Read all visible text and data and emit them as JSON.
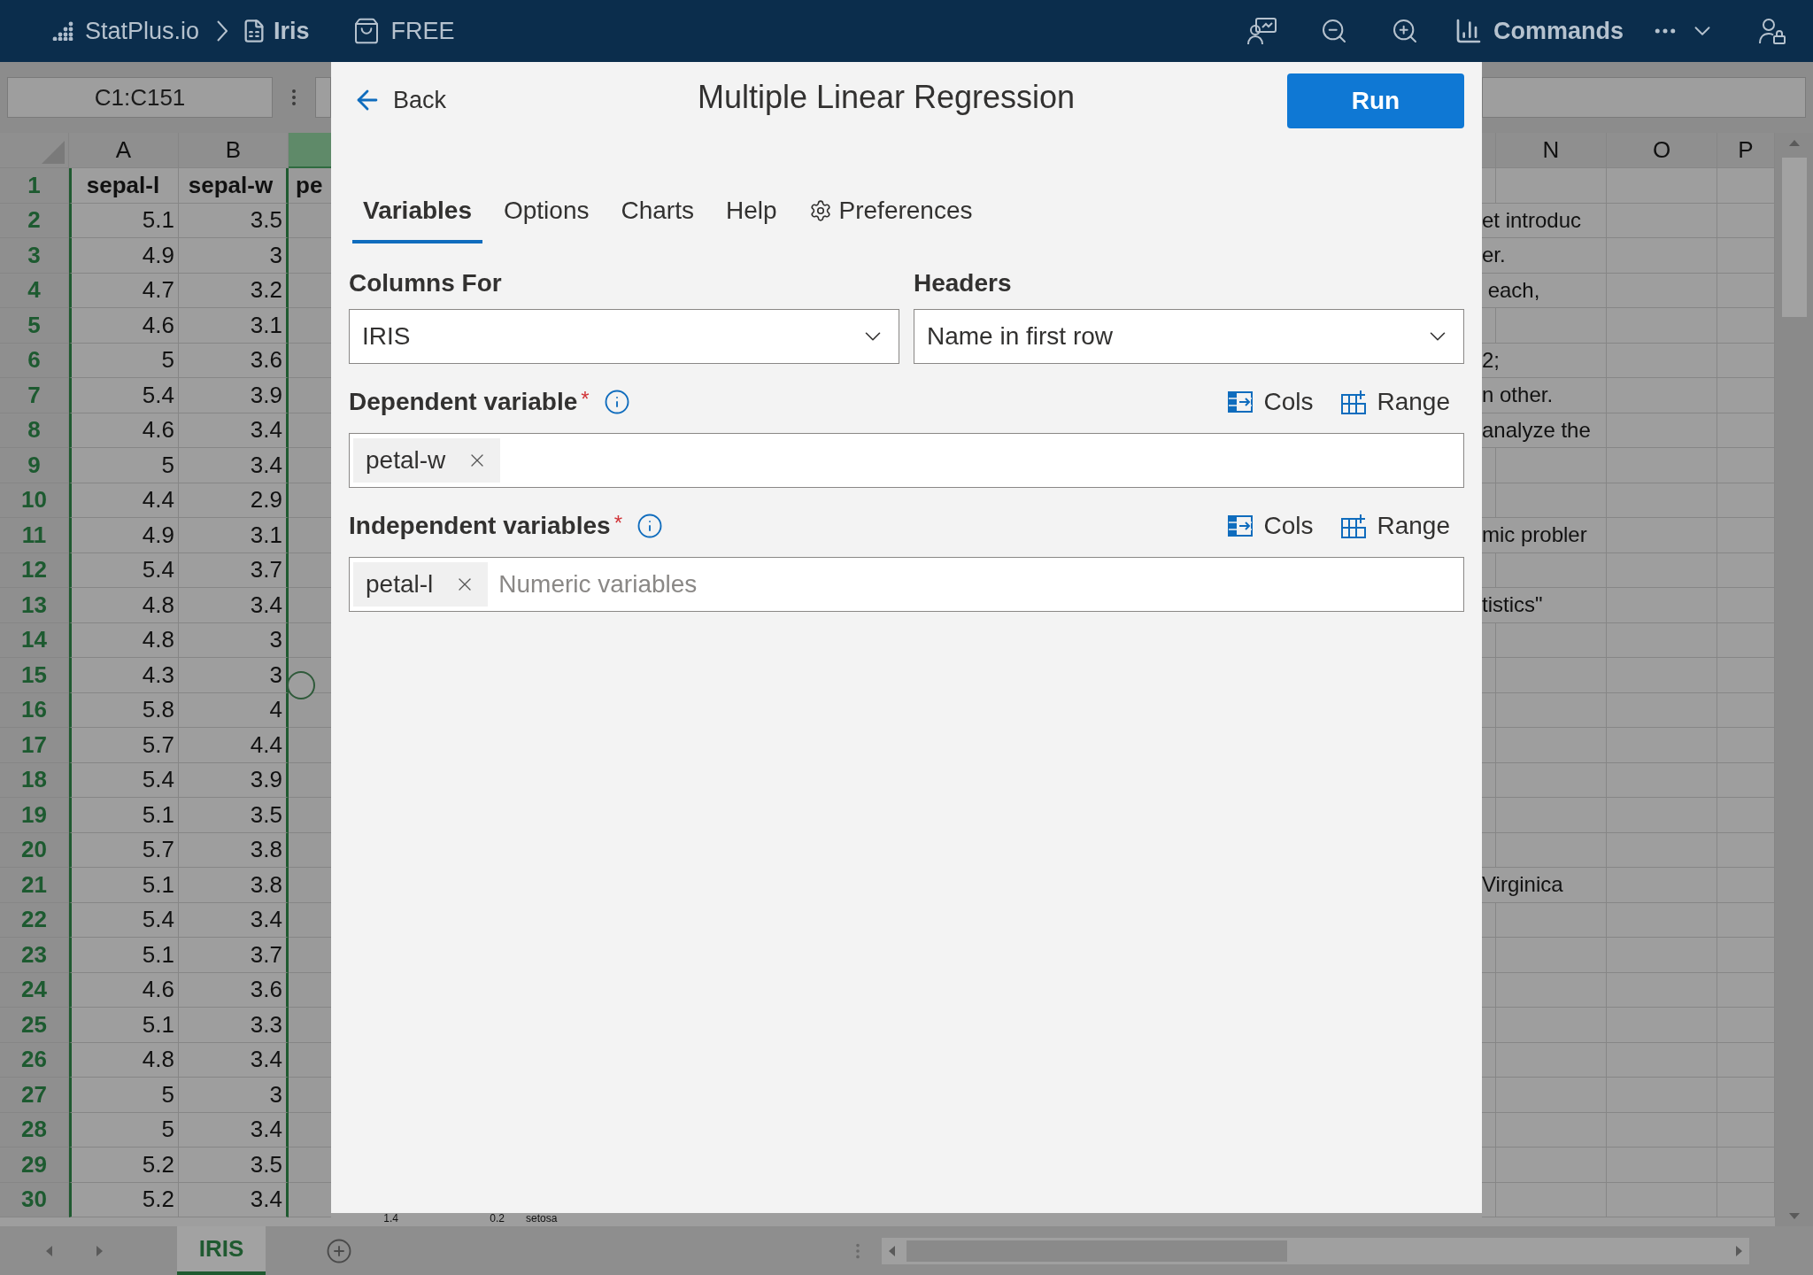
{
  "top_bar": {
    "app": "StatPlus.io",
    "workbook": "Iris",
    "plan": "FREE",
    "commands": "Commands"
  },
  "formula_bar": {
    "cell_ref": "C1:C151"
  },
  "sheet": {
    "columns_left": [
      "A",
      "B"
    ],
    "columns_right": [
      "N",
      "O",
      "P"
    ],
    "rows": [
      {
        "number": "1",
        "a": "sepal-l",
        "b": "sepal-w",
        "c": "pe",
        "note": ""
      },
      {
        "number": "2",
        "a": "5.1",
        "b": "3.5",
        "c": "",
        "note": "et introduc"
      },
      {
        "number": "3",
        "a": "4.9",
        "b": "3",
        "c": "",
        "note": "er."
      },
      {
        "number": "4",
        "a": "4.7",
        "b": "3.2",
        "c": "",
        "note": " each,"
      },
      {
        "number": "5",
        "a": "4.6",
        "b": "3.1",
        "c": "",
        "note": ""
      },
      {
        "number": "6",
        "a": "5",
        "b": "3.6",
        "c": "",
        "note": "2;"
      },
      {
        "number": "7",
        "a": "5.4",
        "b": "3.9",
        "c": "",
        "note": "n other."
      },
      {
        "number": "8",
        "a": "4.6",
        "b": "3.4",
        "c": "",
        "note": "analyze the"
      },
      {
        "number": "9",
        "a": "5",
        "b": "3.4",
        "c": "",
        "note": ""
      },
      {
        "number": "10",
        "a": "4.4",
        "b": "2.9",
        "c": "",
        "note": ""
      },
      {
        "number": "11",
        "a": "4.9",
        "b": "3.1",
        "c": "",
        "note": "mic probler"
      },
      {
        "number": "12",
        "a": "5.4",
        "b": "3.7",
        "c": "",
        "note": ""
      },
      {
        "number": "13",
        "a": "4.8",
        "b": "3.4",
        "c": "",
        "note": "tistics\""
      },
      {
        "number": "14",
        "a": "4.8",
        "b": "3",
        "c": "",
        "note": ""
      },
      {
        "number": "15",
        "a": "4.3",
        "b": "3",
        "c": "",
        "note": ""
      },
      {
        "number": "16",
        "a": "5.8",
        "b": "4",
        "c": "",
        "note": ""
      },
      {
        "number": "17",
        "a": "5.7",
        "b": "4.4",
        "c": "",
        "note": ""
      },
      {
        "number": "18",
        "a": "5.4",
        "b": "3.9",
        "c": "",
        "note": ""
      },
      {
        "number": "19",
        "a": "5.1",
        "b": "3.5",
        "c": "",
        "note": ""
      },
      {
        "number": "20",
        "a": "5.7",
        "b": "3.8",
        "c": "",
        "note": ""
      },
      {
        "number": "21",
        "a": "5.1",
        "b": "3.8",
        "c": "",
        "note": "Virginica"
      },
      {
        "number": "22",
        "a": "5.4",
        "b": "3.4",
        "c": "",
        "note": ""
      },
      {
        "number": "23",
        "a": "5.1",
        "b": "3.7",
        "c": "",
        "note": ""
      },
      {
        "number": "24",
        "a": "4.6",
        "b": "3.6",
        "c": "",
        "note": ""
      },
      {
        "number": "25",
        "a": "5.1",
        "b": "3.3",
        "c": "",
        "note": ""
      },
      {
        "number": "26",
        "a": "4.8",
        "b": "3.4",
        "c": "",
        "note": ""
      },
      {
        "number": "27",
        "a": "5",
        "b": "3",
        "c": "",
        "note": ""
      },
      {
        "number": "28",
        "a": "5",
        "b": "3.4",
        "c": "",
        "note": ""
      },
      {
        "number": "29",
        "a": "5.2",
        "b": "3.5",
        "c": "",
        "note": ""
      },
      {
        "number": "30",
        "a": "5.2",
        "b": "3.4",
        "c": "",
        "note": ""
      }
    ],
    "row_30_below_dialog": [
      "1.4",
      "0.2",
      "setosa"
    ],
    "sheet_tabs": [
      {
        "label": "IRIS",
        "selected": true
      }
    ]
  },
  "dialog": {
    "back": "Back",
    "title": "Multiple Linear Regression",
    "run": "Run",
    "tabs": [
      {
        "label": "Variables",
        "selected": true,
        "kind": "text"
      },
      {
        "label": "Options",
        "selected": false,
        "kind": "text"
      },
      {
        "label": "Charts",
        "selected": false,
        "kind": "text"
      },
      {
        "label": "Help",
        "selected": false,
        "kind": "text"
      },
      {
        "label": "Preferences",
        "selected": false,
        "kind": "settings"
      }
    ],
    "selects": [
      {
        "label": "Columns For",
        "value": "IRIS"
      },
      {
        "label": "Headers",
        "value": "Name in first row"
      }
    ],
    "variable_fields": [
      {
        "label": "Dependent variable",
        "required_mark": "*",
        "cols": "Cols",
        "range": "Range",
        "chips": [
          "petal-w"
        ]
      },
      {
        "label": "Independent variables",
        "required_mark": "*",
        "cols": "Cols",
        "range": "Range",
        "chips": [
          "petal-l"
        ],
        "placeholder": "Numeric variables"
      }
    ]
  }
}
